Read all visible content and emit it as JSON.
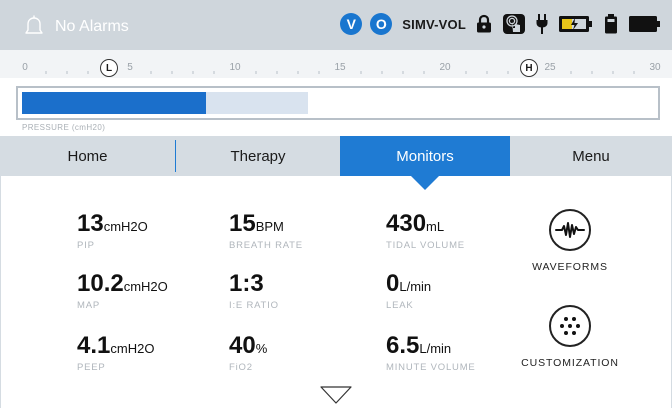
{
  "status": {
    "alarm_text": "No Alarms",
    "badges": [
      "V",
      "O"
    ],
    "mode": "SIMV-VOL",
    "icons": [
      "lock-icon",
      "touch-icon",
      "ac-power-icon",
      "battery-charging-icon",
      "battery-icon",
      "battery-full-icon"
    ]
  },
  "scale": {
    "ticks": [
      "0",
      "5",
      "10",
      "15",
      "20",
      "25",
      "30"
    ],
    "low_marker": "L",
    "high_marker": "H",
    "low_value": 4,
    "high_value": 24
  },
  "pressure": {
    "label": "PRESSURE (cmH20)",
    "current_fraction": 0.29,
    "peak_fraction": 0.45
  },
  "nav": {
    "tabs": [
      "Home",
      "Therapy",
      "Monitors",
      "Menu"
    ],
    "active": "Monitors"
  },
  "metrics": {
    "pip": {
      "value": "13",
      "unit": "cmH2O",
      "label": "PIP"
    },
    "map": {
      "value": "10.2",
      "unit": "cmH2O",
      "label": "MAP"
    },
    "peep": {
      "value": "4.1",
      "unit": "cmH2O",
      "label": "PEEP"
    },
    "breath_rate": {
      "value": "15",
      "unit": "BPM",
      "label": "BREATH RATE"
    },
    "ie_ratio": {
      "value": "1:3",
      "unit": "",
      "label": "I:E RATIO"
    },
    "fio2": {
      "value": "40",
      "unit": "%",
      "label": "FiO2"
    },
    "tidal_volume": {
      "value": "430",
      "unit": "mL",
      "label": "TIDAL VOLUME"
    },
    "leak": {
      "value": "0",
      "unit": "L/min",
      "label": "LEAK"
    },
    "minute_volume": {
      "value": "6.5",
      "unit": "L/min",
      "label": "MINUTE VOLUME"
    }
  },
  "side_buttons": {
    "waveforms": "WAVEFORMS",
    "customization": "CUSTOMIZATION"
  },
  "colors": {
    "accent": "#1f7bd3",
    "status_bar": "#cfd6dc",
    "badge": "#1976cf"
  }
}
